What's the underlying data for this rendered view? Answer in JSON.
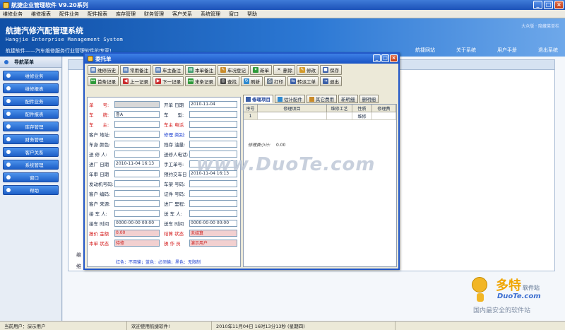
{
  "window": {
    "title": "航捷企业管理软件 V9.20系列"
  },
  "menu": [
    "维修业务",
    "维修报表",
    "配件业务",
    "配件报表",
    "库存管理",
    "财务管理",
    "客户关系",
    "系统管理",
    "窗口",
    "帮助"
  ],
  "header": {
    "title": "航捷汽修汽配管理系统",
    "subtitle": "Hangjie Enterprise Management System",
    "slogan": "航捷软件——汽车维修服务行业管理软件的专家!",
    "user_info": "大众版 · 隐藏菜单栏",
    "links": [
      "航捷网站",
      "关于系统",
      "用户手册",
      "退出系统"
    ]
  },
  "sidebar": {
    "header": "导航菜单",
    "items": [
      "维修业务",
      "维修报表",
      "配件业务",
      "配件报表",
      "库存管理",
      "财务管理",
      "客户关系",
      "系统管理",
      "窗口",
      "帮助"
    ]
  },
  "background": {
    "label1": "维",
    "label2": "维"
  },
  "dialog": {
    "title": "委托单",
    "toolbar_row1": [
      "维修历史",
      "常用备注",
      "车主备注",
      "本单备注",
      "车况登记",
      "新单",
      "删除",
      "修改",
      "保存"
    ],
    "toolbar_row2": [
      "首条记录",
      "上一记录",
      "下一记录",
      "末条记录",
      "查找",
      "刷新",
      "打印",
      "转派工单",
      "退出"
    ],
    "form": {
      "danhao": {
        "label": "单　　号:",
        "value": ""
      },
      "kaidan_rq": {
        "label": "开单 日期",
        "value": "2010-11-04"
      },
      "chepai": {
        "label": "车　　牌:",
        "value": "鲁A"
      },
      "chexing": {
        "label": "车　　型:",
        "value": ""
      },
      "chezhu": {
        "label": "车　　主:",
        "value": ""
      },
      "chezhu_dh": {
        "label": "车主 电话",
        "value": ""
      },
      "kehu_dz": {
        "label": "客户 地址:",
        "value": ""
      },
      "xiuli_lb": {
        "label": "修理 类别:",
        "value": ""
      },
      "cheshen_ys": {
        "label": "车身 颜色:",
        "value": ""
      },
      "cunyou_l": {
        "label": "残存 油量:",
        "value": ""
      },
      "songxiuren": {
        "label": "送 修 人:",
        "value": ""
      },
      "songxiuren_dh": {
        "label": "送修人电话:",
        "value": ""
      },
      "jinchang_rq": {
        "label": "进厂 日期",
        "value": "2010-11-04 16:13"
      },
      "shougong_dh": {
        "label": "手工单号:",
        "value": ""
      },
      "nianshen_rq": {
        "label": "年审 日期",
        "value": ""
      },
      "yuyue_jc": {
        "label": "预约交车日",
        "value": "2010-11-04 16:13"
      },
      "fadongji_hm": {
        "label": "发动机号码:",
        "value": ""
      },
      "chejia_hm": {
        "label": "车架 号码:",
        "value": ""
      },
      "kehu_bm": {
        "label": "客户 编码:",
        "value": ""
      },
      "zhengjian_hm": {
        "label": "证件 号码:",
        "value": ""
      },
      "kehu_ly": {
        "label": "客户 来源:",
        "value": ""
      },
      "jinchang_lc": {
        "label": "进厂 里程:",
        "value": ""
      },
      "jieche_ren": {
        "label": "接 车 人:",
        "value": ""
      },
      "songche_ren": {
        "label": "送 车 人:",
        "value": ""
      },
      "jieche_sj": {
        "label": "接车 时间",
        "value": "0000-00-00 00:00"
      },
      "songche_sj": {
        "label": "送车 时间",
        "value": "0000-00-00 00:00"
      },
      "baojia_je": {
        "label": "报价 金额",
        "value": "0.00"
      },
      "jiesuan_zt": {
        "label": "结算 状态",
        "value": "未结算"
      },
      "benjian_zt": {
        "label": "本单 状态",
        "value": "待修"
      },
      "caozuoyuan": {
        "label": "操 作 员",
        "value": "演示用户"
      }
    },
    "legend": "红色：不用输；蓝色：必须输；黑色：无限制",
    "tabs": [
      "修理项目",
      "估计配件",
      "其它费用",
      "新明细",
      "删明细"
    ],
    "grid": {
      "columns": [
        "序号",
        "修理项目",
        "维修工艺",
        "性质",
        "修理费"
      ],
      "rows": [
        [
          "1",
          "",
          "",
          "维修",
          ""
        ]
      ]
    },
    "subtotal_label": "修理费小计:",
    "subtotal_value": "0.00"
  },
  "status": {
    "user": "当前用户：演示用户",
    "welcome": "欢迎使用航捷软件!",
    "datetime": "2010年11月04日 16时13分13秒 (星期四)"
  },
  "watermark": {
    "center": "www.DuoTe.com",
    "badge_big": "多特",
    "badge_small": "软件站",
    "badge_url": "DuoTe.com",
    "badge_sub": "国内最安全的软件站"
  },
  "colors": {
    "accent": "#1c52b8",
    "required": "#1c3fd0",
    "readonly": "#d41b1b"
  }
}
